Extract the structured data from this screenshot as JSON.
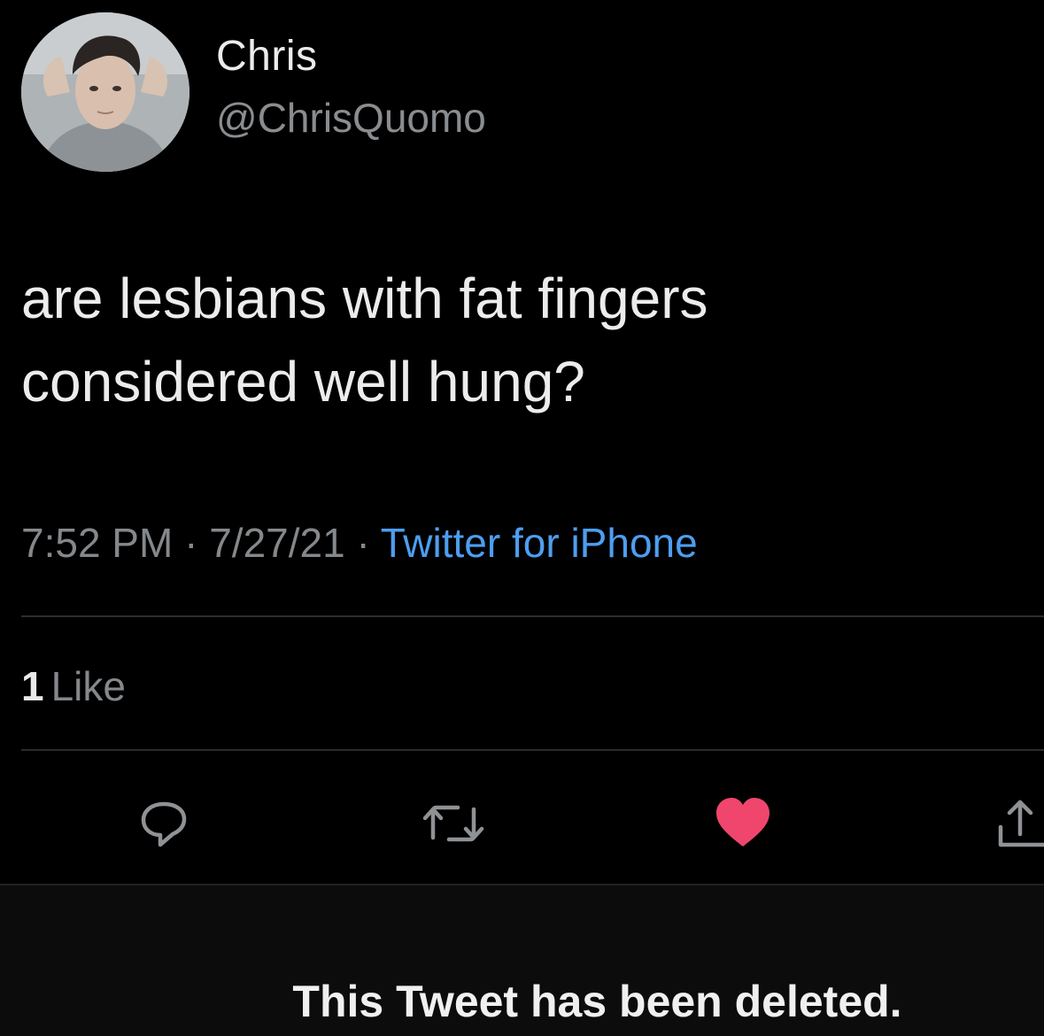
{
  "profile": {
    "display_name": "Chris",
    "handle": "@ChrisQuomo",
    "avatar_icon": "user-photo-avatar"
  },
  "tweet": {
    "text_line_1": "are lesbians with fat fingers",
    "text_line_2": "considered well hung?",
    "time": "7:52 PM",
    "separator": " · ",
    "date": "7/27/21",
    "source": "Twitter for iPhone"
  },
  "stats": {
    "likes_count": "1",
    "likes_label": "Like"
  },
  "actions": {
    "reply_icon": "speech-bubble-icon",
    "retweet_icon": "retweet-icon",
    "like_icon": "heart-icon",
    "share_icon": "share-icon"
  },
  "banner": {
    "deleted_message": "This Tweet has been deleted."
  },
  "colors": {
    "background": "#000000",
    "text_primary": "#ececec",
    "text_secondary": "#85888b",
    "link": "#4d9ef0",
    "like_active": "#f0466e",
    "divider": "#2a2c2e"
  }
}
